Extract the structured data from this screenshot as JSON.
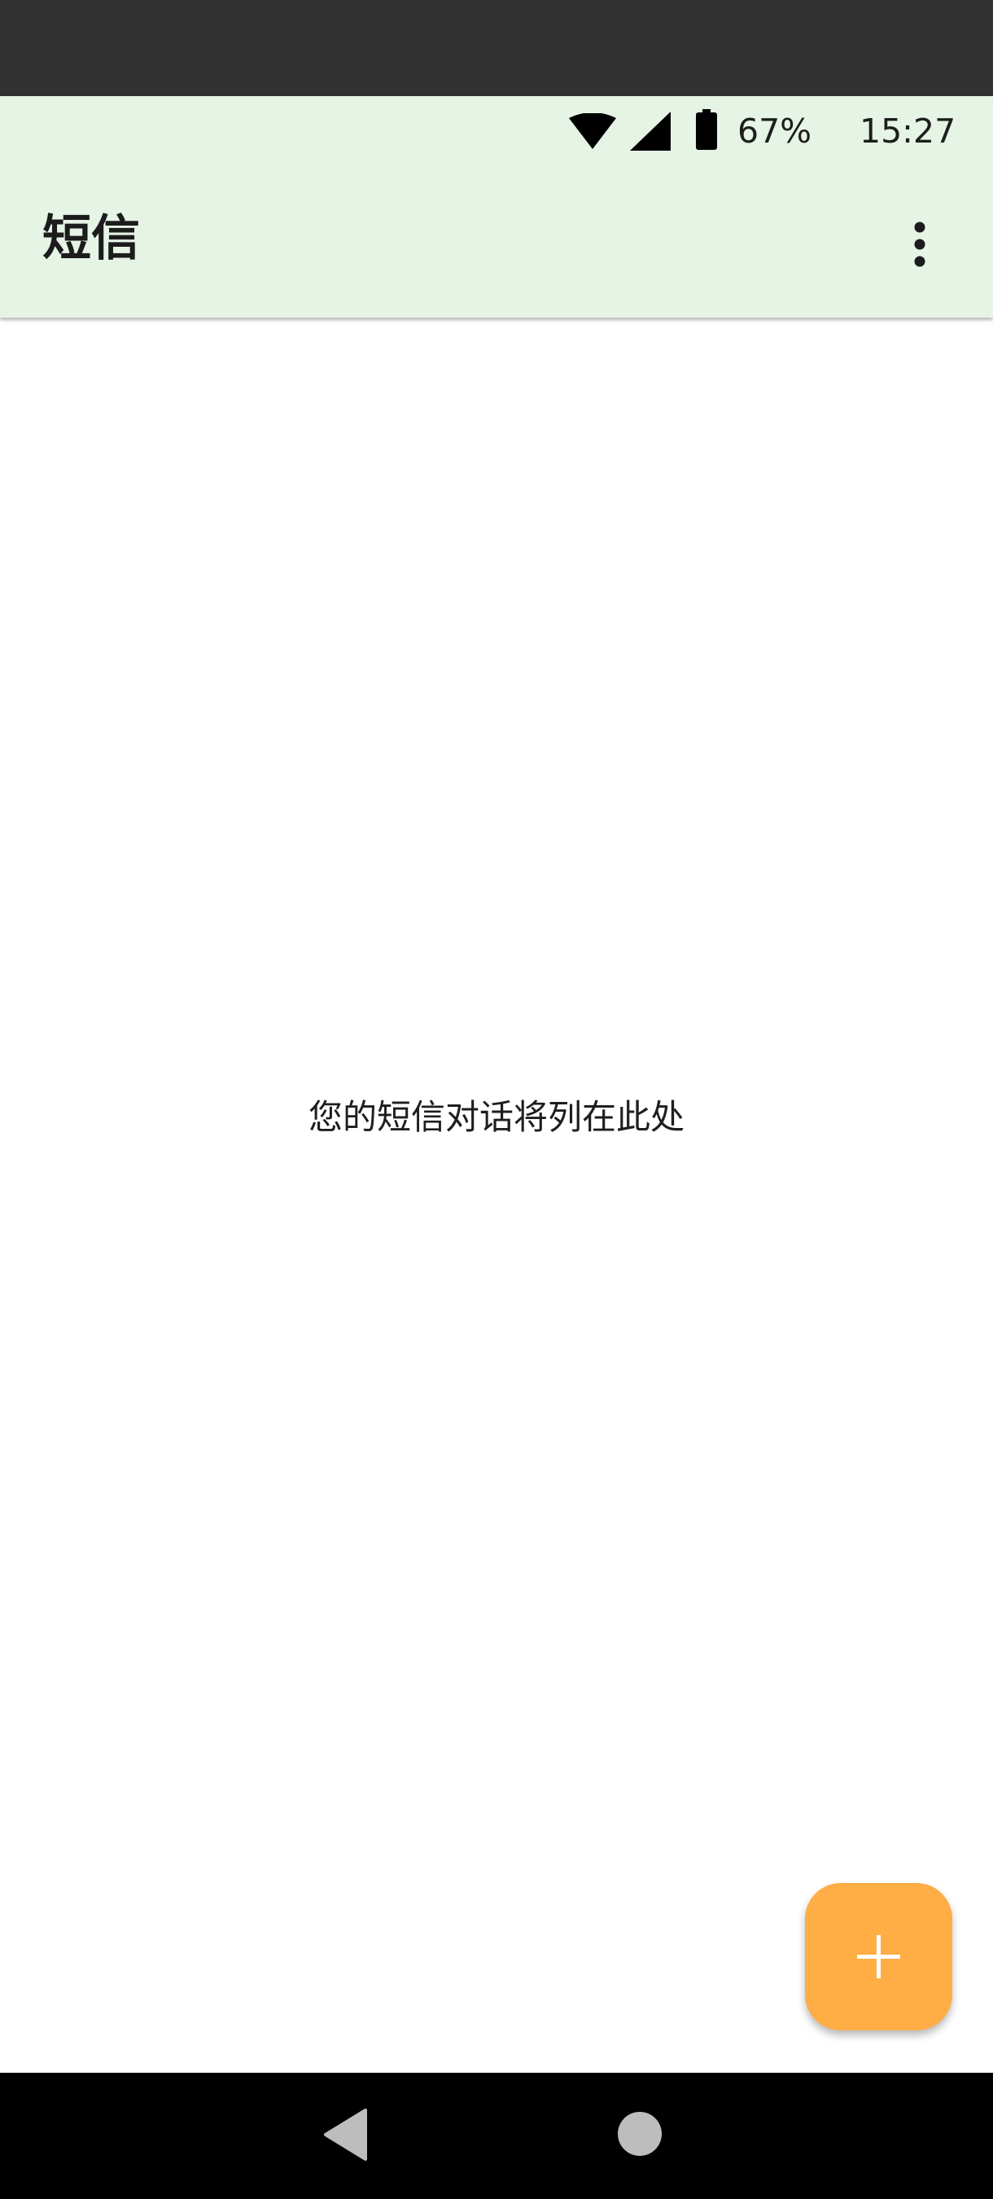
{
  "status_bar": {
    "battery_percent": "67%",
    "time": "15:27",
    "icons": [
      "wifi-icon",
      "cell-signal-icon",
      "battery-icon"
    ]
  },
  "app_bar": {
    "title": "短信",
    "menu_icon": "more-vert-icon"
  },
  "main": {
    "empty_message": "您的短信对话将列在此处"
  },
  "fab": {
    "icon": "plus-icon"
  },
  "nav_bar": {
    "icons": [
      "back-icon",
      "home-icon"
    ]
  },
  "colors": {
    "app_bar_background": "#e5f4e5",
    "fab_background": "#ffad45",
    "top_background": "#323232",
    "nav_background": "#000000"
  }
}
